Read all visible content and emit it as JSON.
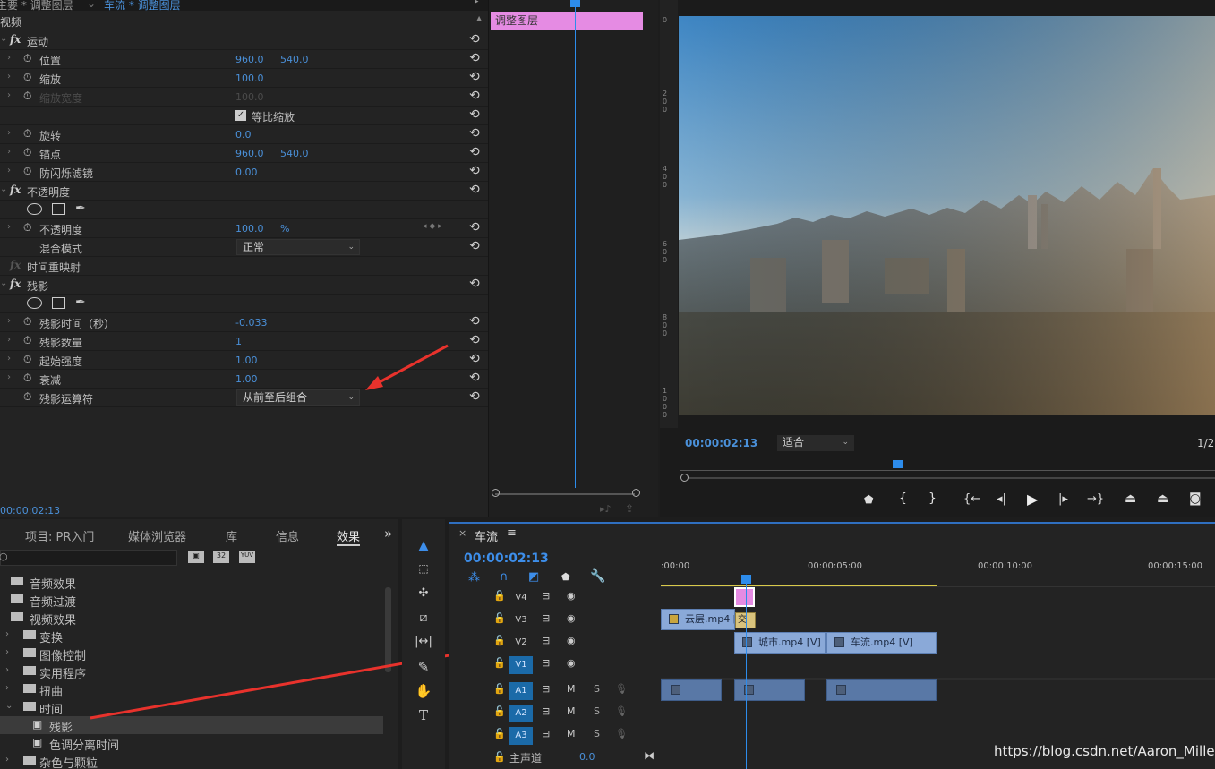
{
  "effect_controls": {
    "tab_source": "主要 * 调整图层",
    "tab_sequence": "车流 * 调整图层",
    "section": "视频",
    "rows": [
      {
        "kind": "fx",
        "label": "运动"
      },
      {
        "kind": "prop",
        "label": "位置",
        "v1": "960.0",
        "v2": "540.0"
      },
      {
        "kind": "prop",
        "label": "缩放",
        "v1": "100.0",
        "v2": ""
      },
      {
        "kind": "prop",
        "label": "缩放宽度",
        "v1": "100.0",
        "v2": ""
      },
      {
        "kind": "check",
        "label": "等比缩放"
      },
      {
        "kind": "prop",
        "label": "旋转",
        "v1": "0.0",
        "v2": ""
      },
      {
        "kind": "prop",
        "label": "锚点",
        "v1": "960.0",
        "v2": "540.0"
      },
      {
        "kind": "prop",
        "label": "防闪烁滤镜",
        "v1": "0.00",
        "v2": ""
      },
      {
        "kind": "fx",
        "label": "不透明度"
      },
      {
        "kind": "masks"
      },
      {
        "kind": "prop",
        "label": "不透明度",
        "v1": "100.0",
        "v2": "%"
      },
      {
        "kind": "select",
        "label": "混合模式",
        "value": "正常"
      },
      {
        "kind": "fx",
        "label": "时间重映射"
      },
      {
        "kind": "fx",
        "label": "残影"
      },
      {
        "kind": "masks"
      },
      {
        "kind": "prop",
        "label": "残影时间（秒）",
        "v1": "-0.033",
        "v2": ""
      },
      {
        "kind": "prop",
        "label": "残影数量",
        "v1": "1",
        "v2": ""
      },
      {
        "kind": "prop",
        "label": "起始强度",
        "v1": "1.00",
        "v2": ""
      },
      {
        "kind": "prop",
        "label": "衰减",
        "v1": "1.00",
        "v2": ""
      },
      {
        "kind": "select",
        "label": "残影运算符",
        "value": "从前至后组合"
      }
    ],
    "timecode": "00:00:02:13",
    "clip_label": "调整图层"
  },
  "program": {
    "timecode": "00:00:02:13",
    "fit": "适合",
    "resolution": "1/2"
  },
  "project_panel": {
    "tabs": [
      "项目: PR入门",
      "媒体浏览器",
      "库",
      "信息",
      "效果"
    ],
    "active_tab": "效果",
    "overflow": "»",
    "tree": [
      {
        "label": "音频效果",
        "indent": 0,
        "chev": "",
        "folder": true
      },
      {
        "label": "音频过渡",
        "indent": 0,
        "chev": "",
        "folder": true
      },
      {
        "label": "视频效果",
        "indent": 0,
        "chev": "",
        "folder": true
      },
      {
        "label": "变换",
        "indent": 1,
        "chev": "›",
        "folder": true
      },
      {
        "label": "图像控制",
        "indent": 1,
        "chev": "›",
        "folder": true
      },
      {
        "label": "实用程序",
        "indent": 1,
        "chev": "›",
        "folder": true
      },
      {
        "label": "扭曲",
        "indent": 1,
        "chev": "›",
        "folder": true
      },
      {
        "label": "时间",
        "indent": 1,
        "chev": "⌄",
        "folder": true
      },
      {
        "label": "残影",
        "indent": 2,
        "chev": "",
        "folder": false,
        "selected": true
      },
      {
        "label": "色调分离时间",
        "indent": 2,
        "chev": "",
        "folder": false
      },
      {
        "label": "杂色与颗粒",
        "indent": 1,
        "chev": "›",
        "folder": true
      }
    ]
  },
  "timeline": {
    "sequence_name": "车流",
    "timecode": "00:00:02:13",
    "ruler": [
      ":00:00",
      "00:00:05:00",
      "00:00:10:00",
      "00:00:15:00"
    ],
    "tracks": [
      {
        "name": "V4",
        "type": "video",
        "active": false
      },
      {
        "name": "V3",
        "type": "video",
        "active": false
      },
      {
        "name": "V2",
        "type": "video",
        "active": false
      },
      {
        "name": "V1",
        "type": "video",
        "active": true
      },
      {
        "name": "A1",
        "type": "audio",
        "active": true
      },
      {
        "name": "A2",
        "type": "audio",
        "active": true
      },
      {
        "name": "A3",
        "type": "audio",
        "active": true
      }
    ],
    "master": {
      "label": "主声道",
      "value": "0.0"
    },
    "clips": {
      "v3_a": "云层.mp4 [",
      "v3_b": "交叉",
      "v2_a": "城市.mp4 [V]",
      "v2_b": "车流.mp4 [V]"
    },
    "m_label": "M",
    "s_label": "S"
  },
  "watermark": "https://blog.csdn.net/Aaron_Miller"
}
